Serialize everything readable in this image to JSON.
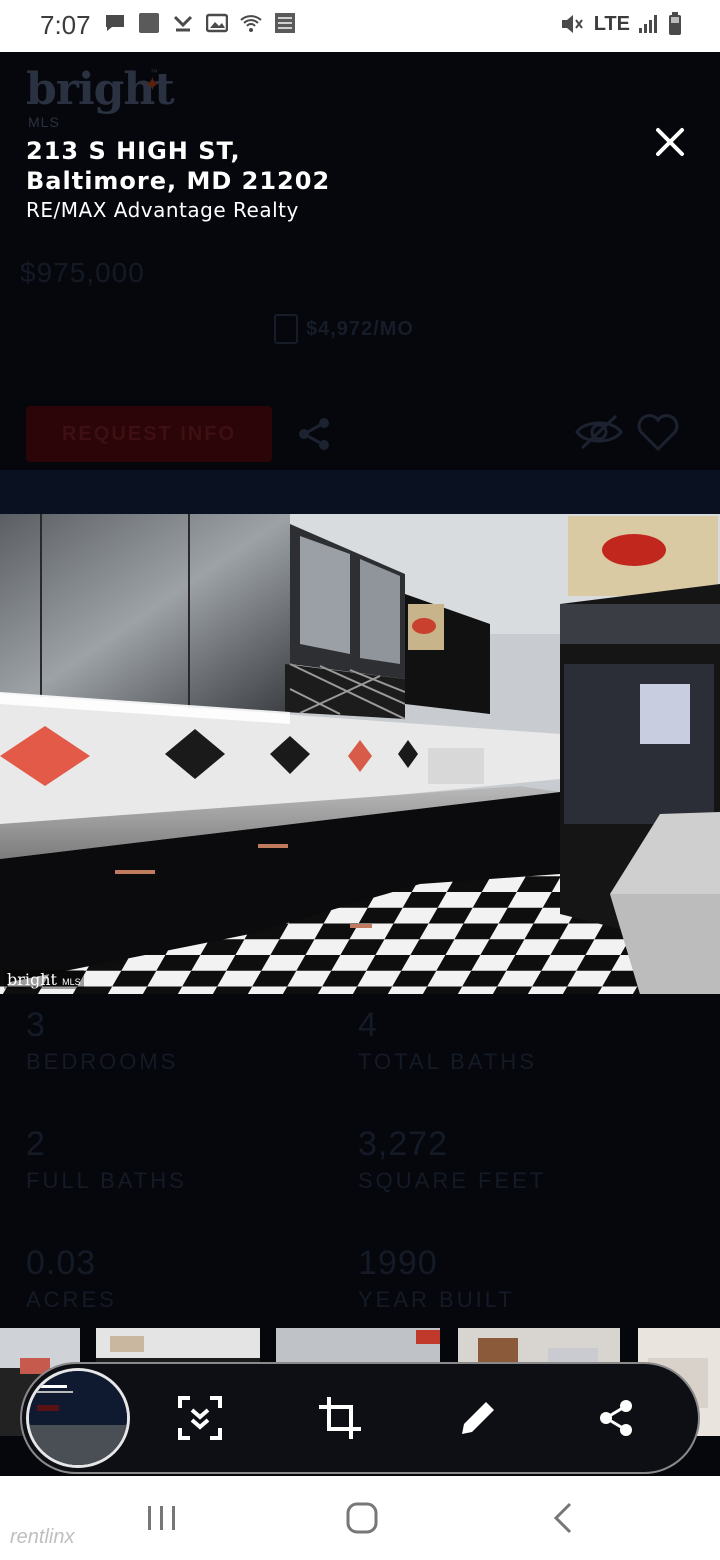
{
  "status_bar": {
    "time": "7:07",
    "network": "LTE"
  },
  "listing": {
    "logo": {
      "brand": "bright",
      "sub": "MLS"
    },
    "address_line1": "213 S HIGH ST,",
    "address_line2": "Baltimore, MD 21202",
    "agency": "RE/MAX Advantage Realty",
    "price": "$975,000",
    "monthly": "$4,972/MO",
    "request_info_label": "REQUEST INFO",
    "photo_watermark": "bright",
    "photo_watermark_sub": "MLS",
    "stats": [
      {
        "value": "3",
        "label": "BEDROOMS"
      },
      {
        "value": "4",
        "label": "TOTAL BATHS"
      },
      {
        "value": "2",
        "label": "FULL BATHS"
      },
      {
        "value": "3,272",
        "label": "SQUARE FEET"
      },
      {
        "value": "0.03",
        "label": "ACRES"
      },
      {
        "value": "1990",
        "label": "YEAR BUILT"
      }
    ]
  },
  "toolbar": {
    "buttons": [
      "scroll-capture",
      "crop",
      "draw",
      "share"
    ]
  },
  "navbar": {
    "watermark": "rentlinx"
  },
  "colors": {
    "overlay_bg": "#05070d",
    "request_btn": "#2b0508",
    "toolbar_bg": "#0d0f14"
  }
}
